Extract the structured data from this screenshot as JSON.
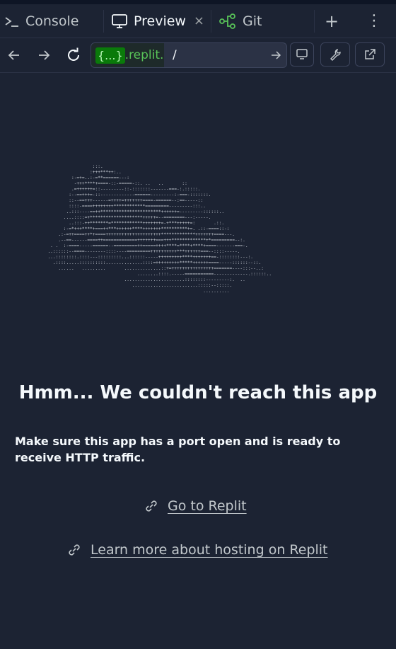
{
  "tabs": {
    "console": {
      "label": "Console",
      "icon": "terminal-icon"
    },
    "preview": {
      "label": "Preview",
      "icon": "monitor-icon",
      "close": "×"
    },
    "git": {
      "label": "Git",
      "icon": "git-branch-icon"
    },
    "add": "+",
    "more": "⋮"
  },
  "toolbar": {
    "url_badge": "{...}",
    "url_host": ".replit.c",
    "url_path": "/"
  },
  "ascii_art": "                   :::.\n                  :+++***++:..\n           :-=+=..:-=**======---:\n            -+++****+====-::-=====-::. ..   ..       ::\n           .=++++++=::---------::-:::::::-------===-:.:::::.\n          :--==+++=-::-------------======---------:-===-:::::::.\n          ::--==+++------=++++=+++++++====-======--:==-----::\n          ::::-====++++++++************=========---------:::..\n         ..:::----==++***********************++++++=---------::::::..\n        ....::::=+********************+++++=--========---:-----.\n          ..:::-++*******=************+++++++=-+***+++++=:       .::.\n        :-=*+++****+===++***++++++****+++++++**********+=. .::-====::-:\n      .:-=++====++*+====+++++++++++++++++++++*************+++++++====---.\n      .--==------====++=============+++++++===+++*************+*=========--:.\n   . .  :-====-----======--=========++=====++++****=****+****+====-------===-.\n  ..::::::--====--------::::----=========++++++++++***++++++===--::::-----.\n  ...::::::::.::::---:::::::::...::::::-----+++++++++****+++++++==-::::::::---:.\n    .::::.....::::::::::..............::::=+++++++++*****++++++====-----::::::--::.\n      ......   .........       ..............::+=++++++++++++++++=======----:::--..:\n                                    ........::::.-----===========-------------.::::::..\n                               .......................::::::::---------:.  ..\n                                  .........................:::::--:::::.\n                                                             ..........",
  "message": {
    "title": "Hmm... We couldn't reach this app",
    "description": "Make sure this app has a port open and is ready to receive HTTP traffic."
  },
  "links": {
    "go_to_replit": "Go to Replit",
    "learn_more": "Learn more about hosting on Replit"
  },
  "colors": {
    "background": "#1c2333",
    "url_green": "#58c258",
    "text": "#f5f9fc",
    "muted": "#c2c8cc"
  }
}
